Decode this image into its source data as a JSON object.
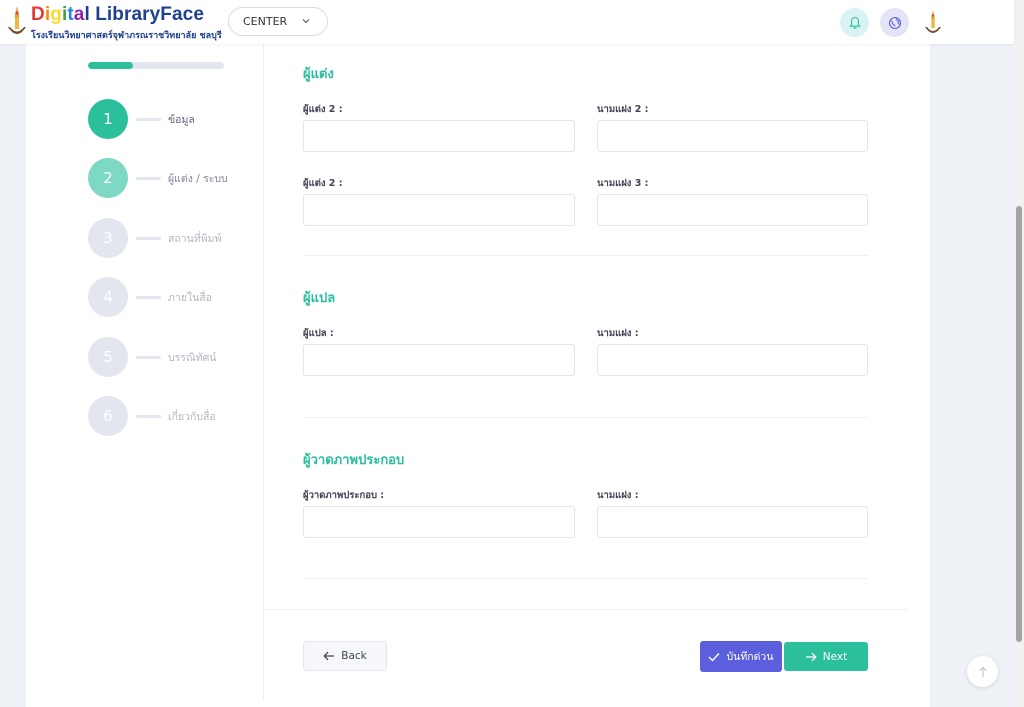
{
  "header": {
    "brand_colored": [
      "D",
      "i",
      "g",
      "i",
      "t",
      "a"
    ],
    "brand_rest": "l LibraryFace",
    "subtitle": "โรงเรียนวิทยาศาสตร์จุฬาภรณราชวิทยาลัย ชลบุรี",
    "center_select_value": "CENTER",
    "icons": [
      "bell-icon",
      "globe-icon"
    ],
    "brand_colors": [
      "#e53935",
      "#fb8c00",
      "#fdd835",
      "#43a047",
      "#1e88e5",
      "#8e24aa",
      "#1f3f8f"
    ]
  },
  "stepper": {
    "progress_fraction": 0.33,
    "steps": [
      {
        "number": "1",
        "label": "ข้อมูล",
        "state": "active"
      },
      {
        "number": "2",
        "label": "ผู้แต่ง / ระบบ",
        "state": "current"
      },
      {
        "number": "3",
        "label": "สถานที่พิมพ์",
        "state": "pending"
      },
      {
        "number": "4",
        "label": "ภายในสื่อ",
        "state": "pending"
      },
      {
        "number": "5",
        "label": "บรรณิทัศน์",
        "state": "pending"
      },
      {
        "number": "6",
        "label": "เกี่ยวกับสื่อ",
        "state": "pending"
      }
    ]
  },
  "form": {
    "authors": {
      "title": "ผู้แต่ง",
      "row1": {
        "left_label": "ผู้แต่ง 2 :",
        "right_label": "นามแฝง 2 :",
        "left_value": "",
        "right_value": ""
      },
      "row2": {
        "left_label": "ผู้แต่ง 2 :",
        "right_label": "นามแฝง 3 :",
        "left_value": "",
        "right_value": ""
      }
    },
    "translator": {
      "title": "ผู้แปล",
      "left_label": "ผู้แปล :",
      "right_label": "นามแฝง :",
      "left_value": "",
      "right_value": ""
    },
    "illustrator": {
      "title": "ผู้วาดภาพประกอบ",
      "left_label": "ผู้วาดภาพประกอบ :",
      "right_label": "นามแฝง :",
      "left_value": "",
      "right_value": ""
    }
  },
  "actions": {
    "back_label": "Back",
    "save_label": "บันทึกด่วน",
    "next_label": "Next"
  },
  "colors": {
    "accent": "#2bbf9c",
    "save": "#5c5fdd"
  }
}
